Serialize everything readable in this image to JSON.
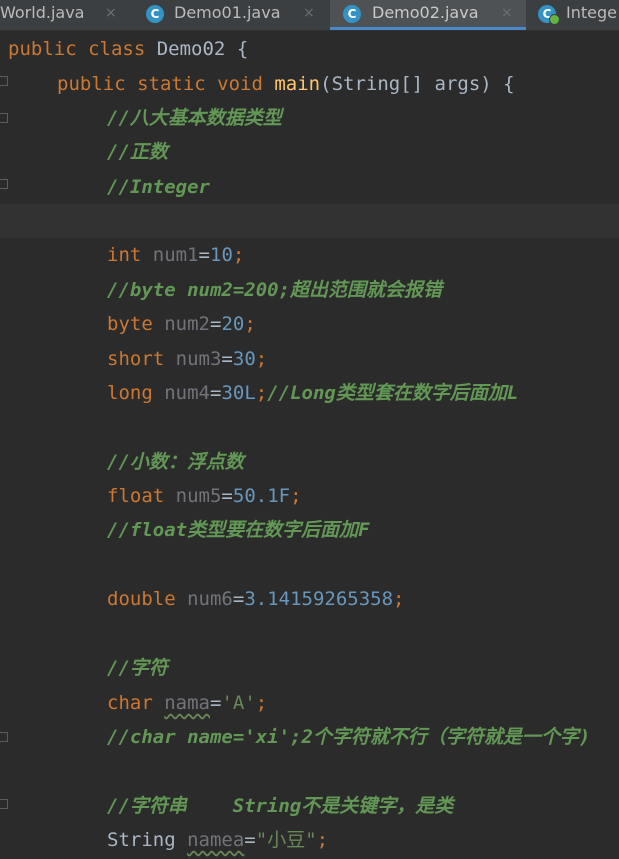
{
  "tabs": [
    {
      "label": "World.java",
      "close": "×"
    },
    {
      "label": "Demo01.java",
      "close": "×"
    },
    {
      "label": "Demo02.java",
      "close": "×",
      "active": true
    },
    {
      "label": "Intege"
    }
  ],
  "tab_icon_letter": "C",
  "code": {
    "class_decl": {
      "kw": "public class",
      "name": "Demo02",
      "brace": "{"
    },
    "main_decl": {
      "kw": "public static void",
      "name": "main",
      "params": "(String[] args) {"
    },
    "comments": {
      "c1": "//八大基本数据类型",
      "c2": "//正数",
      "c3": "//Integer",
      "c4": "//byte num2=200;超出范围就会报错",
      "c5": "//Long类型套在数字后面加L",
      "c6": "//小数：浮点数",
      "c7": "//float类型要在数字后面加F",
      "c8": "//字符",
      "c9": "//char name='xi';2个字符就不行（字符就是一个字)",
      "c10": "//字符串    String不是关键字，是类"
    },
    "int_line": {
      "type": "int",
      "var": "num1",
      "eq": "=",
      "val": "10",
      "end": ";"
    },
    "byte_line": {
      "type": "byte",
      "var": "num2",
      "eq": "=",
      "val": "20",
      "end": ";"
    },
    "short_line": {
      "type": "short",
      "var": "num3",
      "eq": "=",
      "val": "30",
      "end": ";"
    },
    "long_line": {
      "type": "long",
      "var": "num4",
      "eq": "=",
      "val": "30L",
      "end": ";"
    },
    "float_line": {
      "type": "float",
      "var": "num5",
      "eq": "=",
      "val": "50.1F",
      "end": ";"
    },
    "double_line": {
      "type": "double",
      "var": "num6",
      "eq": "=",
      "val": "3.14159265358",
      "end": ";"
    },
    "char_line": {
      "type": "char",
      "var": "nama",
      "eq": "=",
      "val": "'A'",
      "end": ";"
    },
    "string_line": {
      "type": "String",
      "var": "namea",
      "eq": "=",
      "val": "\"小豆\"",
      "end": ";"
    }
  },
  "colors": {
    "background": "#2b2b2b",
    "keyword": "#cc7832",
    "comment": "#629755",
    "number": "#6897bb",
    "string": "#6a8759",
    "method": "#ffc66d",
    "tab_accent": "#4a88c7"
  }
}
